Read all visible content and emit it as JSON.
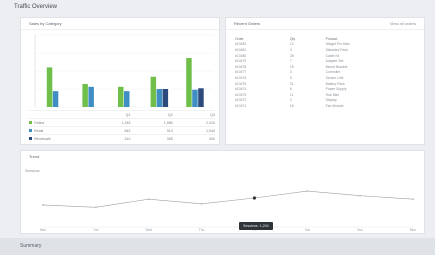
{
  "page": {
    "title": "Traffic Overview"
  },
  "panels": {
    "chart": {
      "title": "Sales by Category"
    },
    "table": {
      "title": "Recent Orders",
      "action": "View all orders"
    },
    "trend": {
      "title": "Trend",
      "y_label": "Sessions"
    }
  },
  "chart_data": [
    {
      "type": "bar",
      "series": [
        {
          "name": "Online",
          "color": "#6fbf4a",
          "values": [
            55,
            32,
            28,
            42,
            68
          ]
        },
        {
          "name": "Retail",
          "color": "#3f8fc4",
          "values": [
            22,
            28,
            22,
            25,
            24
          ]
        },
        {
          "name": "Wholesale",
          "color": "#2c4a7c",
          "values": [
            0,
            0,
            0,
            25,
            26
          ]
        }
      ],
      "ylim": [
        0,
        100
      ]
    },
    {
      "type": "line",
      "x": [
        1,
        2,
        3,
        4,
        5,
        6,
        7,
        8
      ],
      "series": [
        {
          "name": "Sessions",
          "color": "#9aa1a8",
          "values": [
            38,
            34,
            48,
            40,
            50,
            62,
            54,
            48
          ]
        }
      ],
      "ylim": [
        0,
        100
      ]
    }
  ],
  "legend": {
    "headers": [
      "",
      "Q1",
      "Q2",
      "Q3"
    ],
    "rows": [
      {
        "name": "Online",
        "color": "#6fbf4a",
        "cells": [
          "1,245",
          "1,580",
          "2,310"
        ]
      },
      {
        "name": "Retail",
        "color": "#3f8fc4",
        "cells": [
          "842",
          "913",
          "1,044"
        ]
      },
      {
        "name": "Wholesale",
        "color": "#2c4a7c",
        "cells": [
          "310",
          "355",
          "492"
        ]
      }
    ]
  },
  "orders": {
    "headers": [
      "Order",
      "Qty",
      "Product"
    ],
    "rows": [
      [
        "#10482",
        "12",
        "Widget Pro Max"
      ],
      [
        "#10481",
        "4",
        "Standard Pack"
      ],
      [
        "#10480",
        "28",
        "Cable Kit"
      ],
      [
        "#10479",
        "7",
        "Adapter Set"
      ],
      [
        "#10478",
        "15",
        "Mount Bracket"
      ],
      [
        "#10477",
        "3",
        "Controller"
      ],
      [
        "#10476",
        "9",
        "Sensor Unit"
      ],
      [
        "#10475",
        "21",
        "Battery Pack"
      ],
      [
        "#10474",
        "6",
        "Power Supply"
      ],
      [
        "#10473",
        "11",
        "Hub Mini"
      ],
      [
        "#10472",
        "2",
        "Display"
      ],
      [
        "#10471",
        "18",
        "Fan Module"
      ]
    ]
  },
  "trend_labels": [
    "Mon",
    "Tue",
    "Wed",
    "Thu",
    "Fri",
    "Sat",
    "Sun",
    "Mon"
  ],
  "tooltip": {
    "text": "Sessions: 1,204"
  },
  "footer": {
    "text": "Summary"
  }
}
